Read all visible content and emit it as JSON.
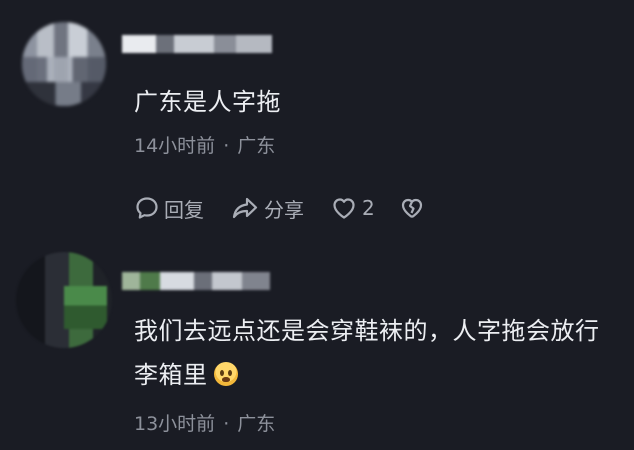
{
  "comments": [
    {
      "text": "广东是人字拖",
      "time": "14小时前",
      "separator": "·",
      "location": "广东",
      "actions": {
        "reply_label": "回复",
        "share_label": "分享",
        "like_count": "2"
      }
    },
    {
      "text": "我们去远点还是会穿鞋袜的，人字拖会放行李箱里",
      "time": "13小时前",
      "separator": "·",
      "location": "广东"
    }
  ],
  "icons": {
    "reply": "speech-bubble-icon",
    "share": "share-arrow-icon",
    "like": "heart-icon",
    "dislike": "broken-heart-icon",
    "emoji": "crying-face-emoji"
  },
  "colors": {
    "background": "#1a1c24",
    "text_primary": "#eceef2",
    "text_secondary": "#8d919b",
    "action_gray": "#a9adb6"
  }
}
